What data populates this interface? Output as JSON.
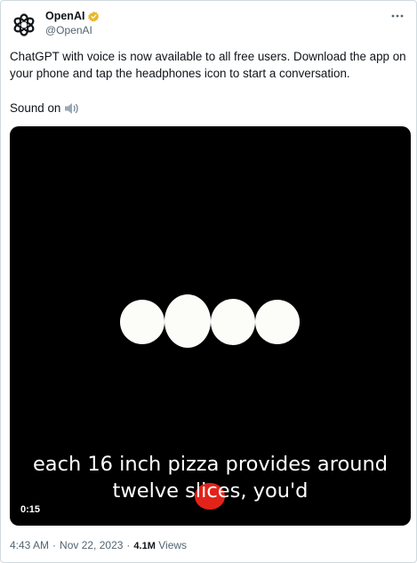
{
  "author": {
    "display_name": "OpenAI",
    "handle": "@OpenAI",
    "avatar_icon": "openai-logo-icon",
    "verified_icon": "verified-badge-icon",
    "verified_color": "#e8b829"
  },
  "more_icon": "more-options-icon",
  "tweet": {
    "text": "ChatGPT with voice is now available to all free users. Download the app on your phone and tap the headphones icon to start a conversation.",
    "sound_label": "Sound on",
    "sound_icon": "speaker-icon"
  },
  "video": {
    "caption_line_1": "each 16 inch pizza provides around",
    "caption_line_2": "twelve slices, you'd",
    "elapsed": "0:15",
    "background_color": "#000000",
    "dot_color": "#fcfcf8"
  },
  "meta": {
    "time": "4:43 AM",
    "separator_1": "·",
    "date": "Nov 22, 2023",
    "separator_2": "·",
    "views_count": "4.1M",
    "views_label": "Views"
  }
}
